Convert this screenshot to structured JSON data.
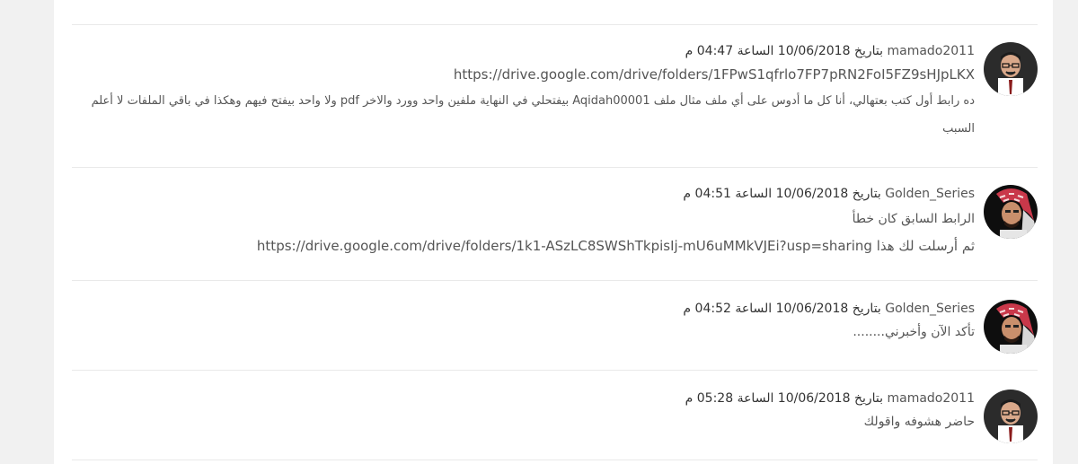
{
  "comments": [
    {
      "author": "mamado2011",
      "date_text": "بتاريخ 10/06/2018 الساعة 04:47 م",
      "lines": [
        "https://drive.google.com/drive/folders/1FPwS1qfrlo7FP7pRN2FoI5FZ9sHJpLKX"
      ],
      "paragraph": "ده رابط أول كتب بعتهالي، أنا كل ما أدوس على أي ملف مثال ملف Aqidah00001 بيفتحلي في النهاية ملفين واحد وورد والاخر pdf ولا واحد بيفتح فيهم وهكذا في باقي الملفات لا أعلم السبب",
      "avatar": "man-glasses-icon"
    },
    {
      "author": "Golden_Series",
      "date_text": "بتاريخ 10/06/2018 الساعة 04:51 م",
      "lines": [
        "الرابط السابق كان خطأ",
        "ثم أرسلت لك هذا https://drive.google.com/drive/folders/1k1-ASzLC8SWShTkpisIj-mU6uMMkVJEi?usp=sharing"
      ],
      "paragraph": "",
      "avatar": "man-shemagh-icon"
    },
    {
      "author": "Golden_Series",
      "date_text": "بتاريخ 10/06/2018 الساعة 04:52 م",
      "lines": [
        "تأكد الآن وأخبرني........"
      ],
      "paragraph": "",
      "avatar": "man-shemagh-icon"
    },
    {
      "author": "mamado2011",
      "date_text": "بتاريخ 10/06/2018 الساعة 05:28 م",
      "lines": [
        "حاضر هشوفه واقولك"
      ],
      "paragraph": "",
      "avatar": "man-glasses-icon"
    }
  ]
}
